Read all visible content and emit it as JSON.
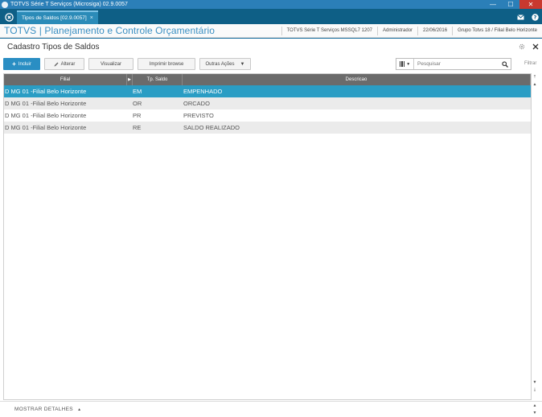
{
  "window": {
    "title": "TOTVS Série T Serviços (Microsiga) 02.9.0057",
    "minimize": "—",
    "maximize": "☐",
    "close": "✕"
  },
  "tabs": [
    {
      "label": "Tipos de Saldos [02.9.0057]",
      "close": "×"
    }
  ],
  "header": {
    "brand": "TOTVS | Planejamento e Controle Orçamentário",
    "environment": "TOTVS Série T Serviços MSSQL7 1207",
    "user": "Administrador",
    "date": "22/06/2016",
    "company": "Grupo Totvs 18 / Filial Belo Horizonte"
  },
  "page": {
    "title": "Cadastro Tipos de Saldos"
  },
  "toolbar": {
    "incluir": "Incluir",
    "alterar": "Alterar",
    "visualizar": "Visualizar",
    "imprimir": "Imprimir browse",
    "outras": "Outras Ações"
  },
  "search": {
    "placeholder": "Pesquisar",
    "filter_label": "Filtrar"
  },
  "grid": {
    "columns": [
      "Filial",
      "Tp. Saldo",
      "Descricao"
    ],
    "rows": [
      {
        "filial": "D MG 01 -Filial Belo Horizonte",
        "tipo": "EM",
        "descricao": "EMPENHADO"
      },
      {
        "filial": "D MG 01 -Filial Belo Horizonte",
        "tipo": "OR",
        "descricao": "ORCADO"
      },
      {
        "filial": "D MG 01 -Filial Belo Horizonte",
        "tipo": "PR",
        "descricao": "PREVISTO"
      },
      {
        "filial": "D MG 01 -Filial Belo Horizonte",
        "tipo": "RE",
        "descricao": "SALDO REALIZADO"
      }
    ],
    "selected_row": 0
  },
  "footer": {
    "details": "MOSTRAR DETALHES"
  },
  "colors": {
    "brand": "#3b8fc2",
    "primary_button": "#2a8ec3",
    "selected_row": "#2a9dc4",
    "tab_bar": "#0e5f86"
  }
}
